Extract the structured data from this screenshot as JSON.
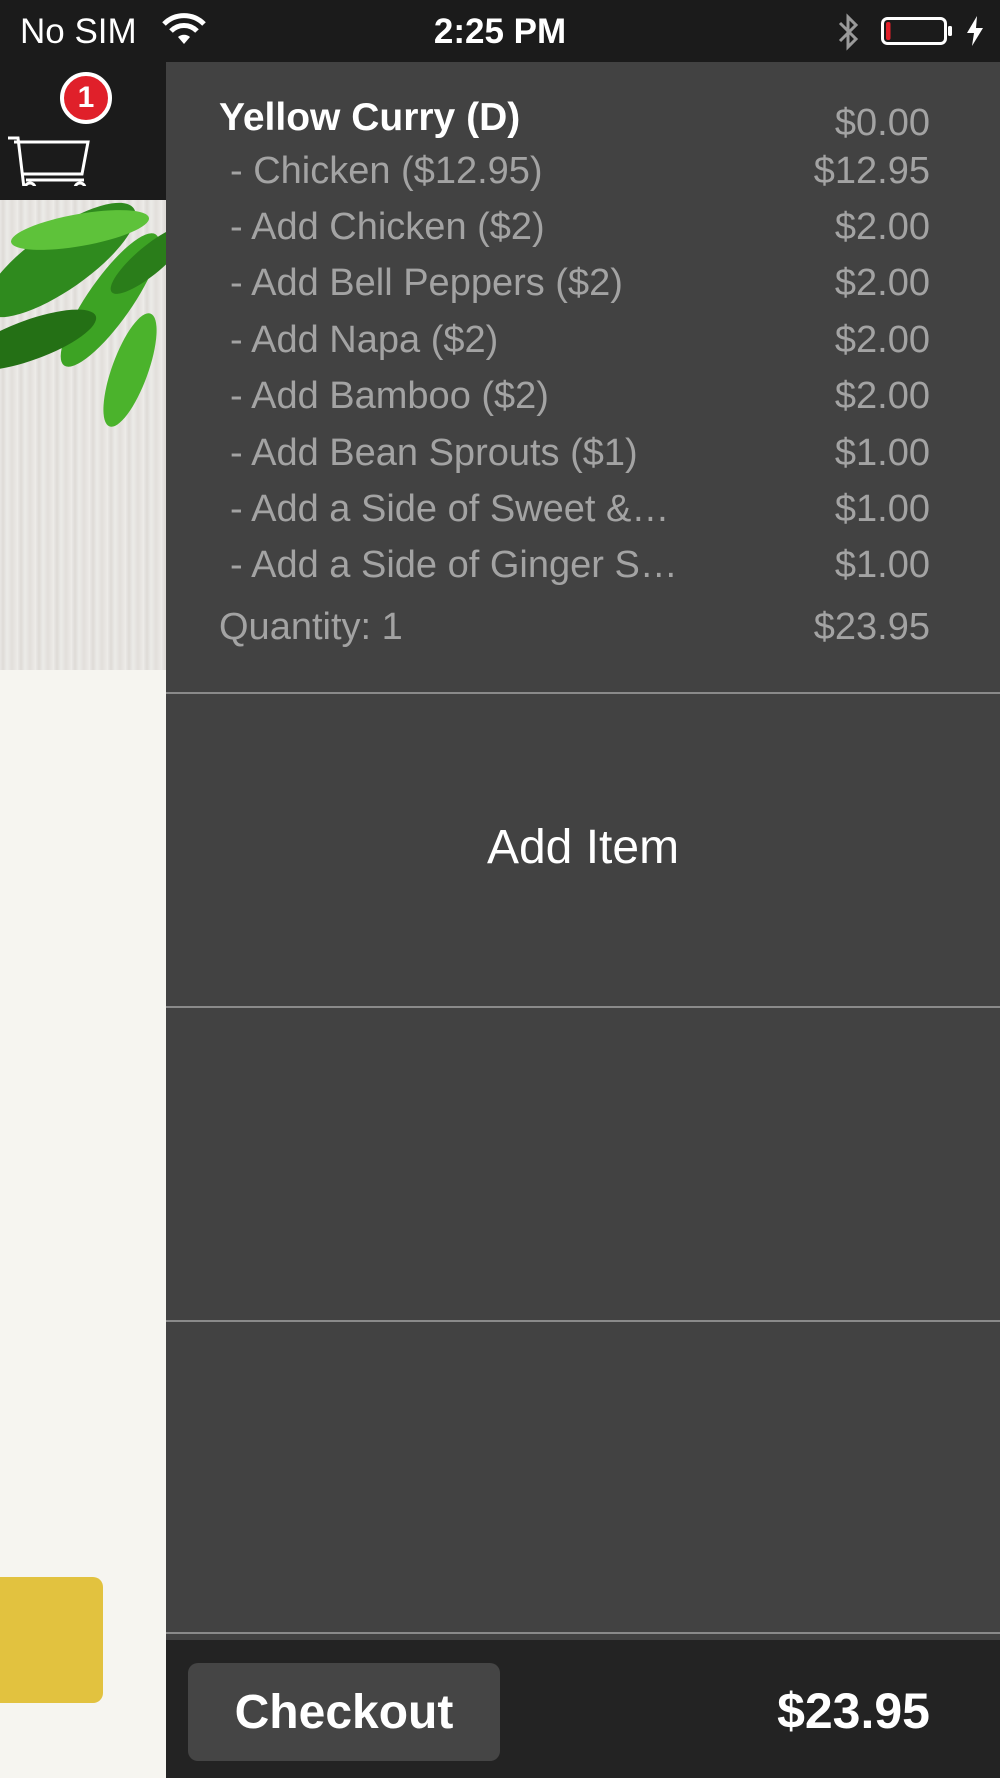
{
  "status_bar": {
    "carrier": "No SIM",
    "time": "2:25 PM",
    "battery_level": 0.08,
    "battery_color": "#e0202a"
  },
  "header": {
    "cart_count": "1",
    "icons": [
      "cart-icon"
    ]
  },
  "cart": {
    "item_name": "Yellow Curry (D)",
    "item_price": "$0.00",
    "options": [
      {
        "label": "- Chicken ($12.95)",
        "price": "$12.95"
      },
      {
        "label": "- Add Chicken ($2)",
        "price": "$2.00"
      },
      {
        "label": "- Add Bell Peppers ($2)",
        "price": "$2.00"
      },
      {
        "label": "- Add Napa ($2)",
        "price": "$2.00"
      },
      {
        "label": "- Add Bamboo ($2)",
        "price": "$2.00"
      },
      {
        "label": "- Add Bean Sprouts ($1)",
        "price": "$1.00"
      },
      {
        "label": "- Add a Side of Sweet &…",
        "price": "$1.00"
      },
      {
        "label": "- Add a Side of Ginger S…",
        "price": "$1.00"
      }
    ],
    "quantity_label": "Quantity: 1",
    "line_total": "$23.95",
    "add_item_label": "Add Item"
  },
  "footer": {
    "checkout_label": "Checkout",
    "total": "$23.95"
  },
  "colors": {
    "panel_bg": "#424242",
    "footer_bg": "#232323",
    "accent_yellow": "#e2c23f",
    "badge_red": "#e0202a"
  }
}
